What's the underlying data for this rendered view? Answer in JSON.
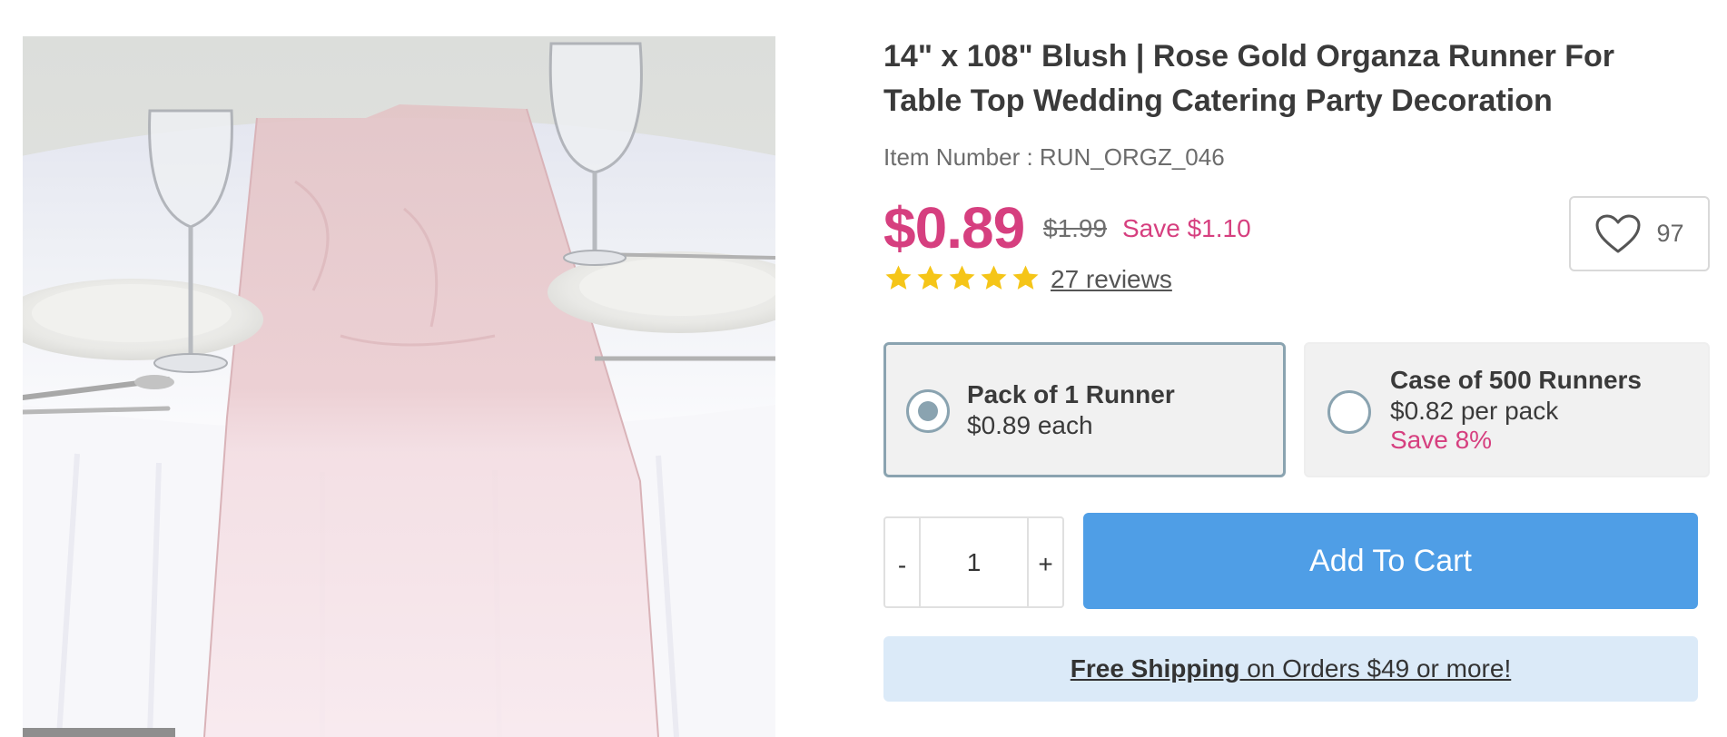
{
  "product": {
    "title": "14\" x 108\" Blush | Rose Gold Organza Runner For Table Top Wedding Catering Party Decoration",
    "item_number": "Item Number : RUN_ORGZ_046",
    "price": "$0.89",
    "old_price": "$1.99",
    "save_amount": "Save $1.10",
    "rating": 5,
    "reviews_label": "27 reviews",
    "wishlist_count": "97",
    "image_alt": "Blush organza runner on a white round table with plates and wine glasses"
  },
  "options": [
    {
      "name": "Pack of 1 Runner",
      "price": "$0.89 each",
      "save": "",
      "selected": true
    },
    {
      "name": "Case of 500 Runners",
      "price": "$0.82 per pack",
      "save": "Save 8%",
      "selected": false
    }
  ],
  "quantity": {
    "minus_label": "-",
    "value": "1",
    "plus_label": "+"
  },
  "cart": {
    "button_label": "Add To Cart"
  },
  "shipping": {
    "bold_text": "Free Shipping",
    "rest_text": " on Orders $49 or more!"
  },
  "colors": {
    "accent_pink": "#d63f7f",
    "cart_blue": "#4f9ee6",
    "star_yellow": "#f5c518",
    "banner_blue": "#dbeaf8",
    "option_border": "#8aa3b0"
  },
  "icons": [
    "star-icon",
    "heart-icon"
  ]
}
